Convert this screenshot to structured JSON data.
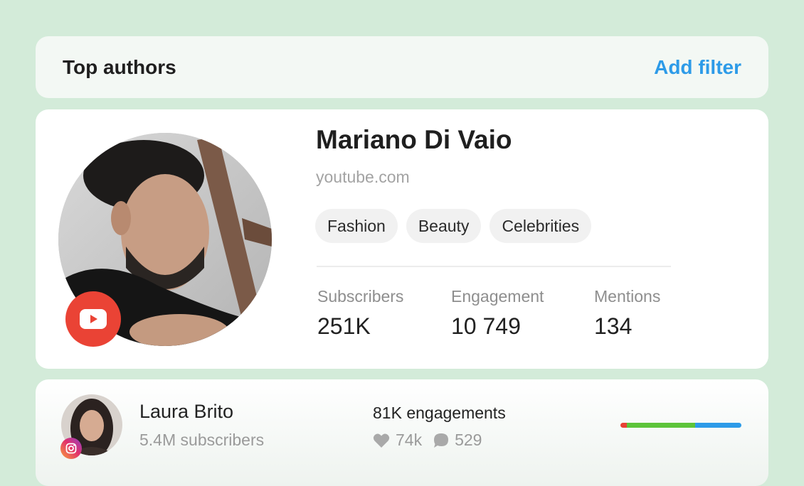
{
  "header": {
    "title": "Top authors",
    "add_filter_label": "Add filter"
  },
  "featured_author": {
    "name": "Mariano Di Vaio",
    "source": "youtube.com",
    "platform_icon": "youtube-icon",
    "tags": [
      "Fashion",
      "Beauty",
      "Celebrities"
    ],
    "stats": [
      {
        "label": "Subscribers",
        "value": "251K"
      },
      {
        "label": "Engagement",
        "value": "10 749"
      },
      {
        "label": "Mentions",
        "value": "134"
      }
    ]
  },
  "author_row": {
    "name": "Laura Brito",
    "subscribers": "5.4M subscribers",
    "engagements": "81K engagements",
    "likes": "74k",
    "comments": "529",
    "platform_icon": "instagram-icon",
    "sentiment": [
      {
        "label": "negative",
        "fraction": 0.05,
        "color": "#e84235"
      },
      {
        "label": "positive",
        "fraction": 0.57,
        "color": "#5dc43a"
      },
      {
        "label": "neutral",
        "fraction": 0.38,
        "color": "#2d9be8"
      }
    ]
  },
  "colors": {
    "background": "#d3ebd9",
    "accent": "#2d9be8",
    "youtube": "#ea4335"
  }
}
